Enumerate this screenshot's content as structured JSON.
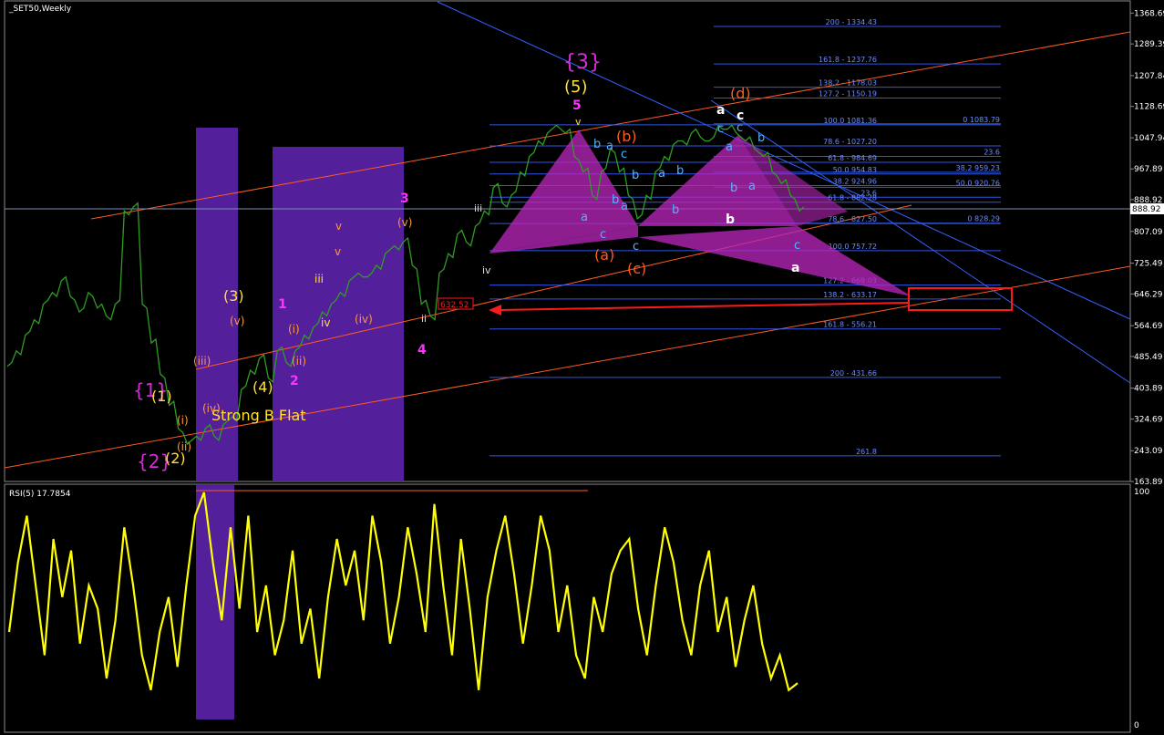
{
  "window": {
    "title": "_SET50,Weekly",
    "current_price": "888.92",
    "target_box_label": "632.52"
  },
  "rsi_panel": {
    "title": "RSI(5) 17.7854",
    "scale_top": "100",
    "scale_bottom": "0"
  },
  "annotations": {
    "strong_b_flat": "Strong B Flat"
  },
  "fib_levels": [
    {
      "label": "200 - 1334.43",
      "price": 1334.43
    },
    {
      "label": "161.8 - 1237.76",
      "price": 1237.76
    },
    {
      "label": "138.2 - 1178.03",
      "price": 1178.03
    },
    {
      "label": "127.2 - 1150.19",
      "price": 1150.19
    },
    {
      "label": "100.0 1081.36",
      "price": 1081.36
    },
    {
      "label": "0 1083.79",
      "price": 1083.79
    },
    {
      "label": "78.6 - 1027.20",
      "price": 1027.2
    },
    {
      "label": "23.6",
      "price": 1000.0
    },
    {
      "label": "61.8 - 984.69",
      "price": 984.69
    },
    {
      "label": "50.0 954.83",
      "price": 954.83
    },
    {
      "label": "38.2 959.23",
      "price": 959.23
    },
    {
      "label": "38.2 924.96",
      "price": 924.96
    },
    {
      "label": "50.0 920.76",
      "price": 920.76
    },
    {
      "label": "23.6",
      "price": 895.0
    },
    {
      "label": "61.8 - 882.28",
      "price": 882.28
    },
    {
      "label": "0 828.29",
      "price": 828.29
    },
    {
      "label": "78.6 - 827.50",
      "price": 827.5
    },
    {
      "label": "100.0 757.72",
      "price": 757.72
    },
    {
      "label": "127.2 - 669.03",
      "price": 669.03
    },
    {
      "label": "138.2 - 633.17",
      "price": 633.17
    },
    {
      "label": "161.8 - 556.21",
      "price": 556.21
    },
    {
      "label": "200 - 431.66",
      "price": 431.66
    },
    {
      "label": "261.8",
      "price": 230.0
    }
  ],
  "wave_labels": [
    "{3}",
    "(5)",
    "5",
    "(d)",
    "(b)",
    "(a)",
    "(c)",
    "{1}",
    "(1)",
    "{2}",
    "(2)",
    "(3)",
    "(4)",
    "1",
    "2",
    "3",
    "4",
    "i",
    "ii",
    "iii",
    "iv",
    "v",
    "(i)",
    "(ii)",
    "(iii)",
    "(iv)",
    "(v)",
    "a",
    "b",
    "c"
  ],
  "chart_data": [
    {
      "type": "line",
      "title": "_SET50,Weekly",
      "ylim": [
        163.89,
        1400
      ],
      "y_ticks": [
        1368.69,
        1289.39,
        1207.84,
        1128.69,
        1047.94,
        967.89,
        888.92,
        807.09,
        725.49,
        646.29,
        564.69,
        485.49,
        403.89,
        324.69,
        243.09,
        163.89
      ],
      "series": [
        {
          "values": [
            460,
            500,
            540,
            580,
            620,
            650,
            680,
            640,
            600,
            650,
            610,
            590,
            620,
            860,
            870,
            620,
            520,
            440,
            360,
            300,
            260,
            280,
            300,
            280,
            310,
            330,
            400,
            450,
            480,
            430,
            500,
            470,
            500,
            540,
            560,
            600,
            620,
            650,
            680,
            700,
            690,
            720,
            750,
            770,
            780,
            720,
            620,
            590,
            700,
            750,
            800,
            780,
            820,
            860,
            920,
            880,
            900,
            960,
            1000,
            1040,
            1060,
            1080,
            1060,
            1000,
            960,
            900,
            960,
            1020,
            960,
            900,
            840,
            900,
            960,
            1000,
            1030,
            1040,
            1060,
            1050,
            1040,
            1080,
            1070,
            1060,
            1040,
            1020,
            1000,
            960,
            930,
            900,
            860
          ]
        }
      ]
    },
    {
      "type": "line",
      "title": "RSI(5) 17.7854",
      "ylim": [
        0,
        100
      ],
      "series": [
        {
          "values": [
            40,
            70,
            90,
            60,
            30,
            80,
            55,
            75,
            35,
            60,
            50,
            20,
            45,
            85,
            60,
            30,
            15,
            40,
            55,
            25,
            60,
            90,
            100,
            70,
            45,
            85,
            50,
            90,
            40,
            60,
            30,
            45,
            75,
            35,
            50,
            20,
            55,
            80,
            60,
            75,
            45,
            90,
            70,
            35,
            55,
            85,
            65,
            40,
            95,
            60,
            30,
            80,
            50,
            15,
            55,
            75,
            90,
            65,
            35,
            60,
            90,
            75,
            40,
            60,
            30,
            20,
            55,
            40,
            65,
            75,
            80,
            50,
            30,
            60,
            85,
            70,
            45,
            30,
            60,
            75,
            40,
            55,
            25,
            45,
            60,
            35,
            20,
            30,
            15,
            18
          ]
        }
      ]
    }
  ]
}
